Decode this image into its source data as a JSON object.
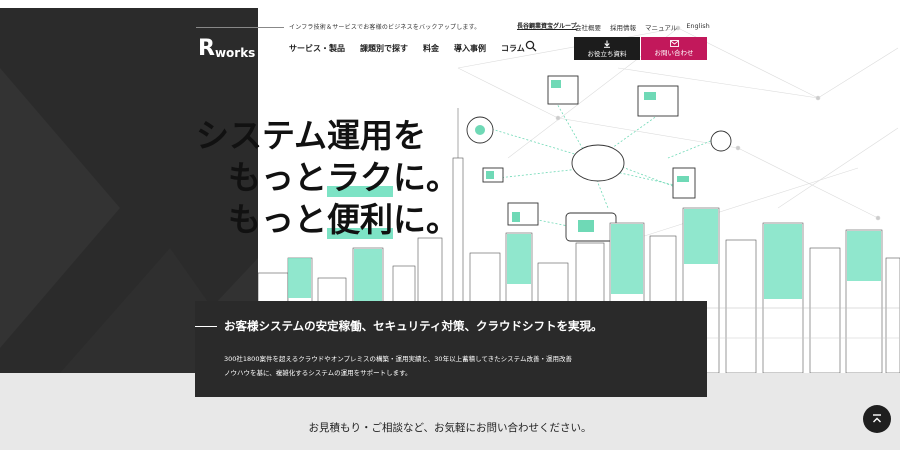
{
  "header": {
    "tagline": "インフラ技術＆サービスでお客様のビジネスをバックアップします。",
    "group_label": "長谷鋼業資宝グループ",
    "top_links": [
      "会社概要",
      "採用情報",
      "マニュアル",
      "English"
    ],
    "logo_r": "R",
    "logo_works": "works",
    "nav": [
      "サービス・製品",
      "課題別で探す",
      "料金",
      "導入事例",
      "コラム"
    ],
    "search_icon": "search-icon",
    "download_label": "お役立ち資料",
    "contact_label": "お問い合わせ",
    "download_icon": "download-icon",
    "contact_icon": "mail-icon",
    "contact_color": "#c2185b"
  },
  "hero": {
    "line1": "システム運用を",
    "line2_a": "もっと",
    "line2_b": "ラク",
    "line2_c": "に。",
    "line3_a": "もっと",
    "line3_b": "便利",
    "line3_c": "に。",
    "highlight_color": "#7de3c5"
  },
  "description": {
    "heading": "お客様システムの安定稼働、セキュリティ対策、クラウドシフトを実現。",
    "body_line1": "300社1800案件を超えるクラウドやオンプレミスの構築・運用実績と、30年以上蓄積してきたシステム改善・運用改善",
    "body_line2": "ノウハウを基に、複雑化するシステムの運用をサポートします。"
  },
  "cta": {
    "text": "お見積もり・ご相談など、お気軽にお問い合わせください。"
  },
  "page_top_icon": "arrow-up-icon"
}
